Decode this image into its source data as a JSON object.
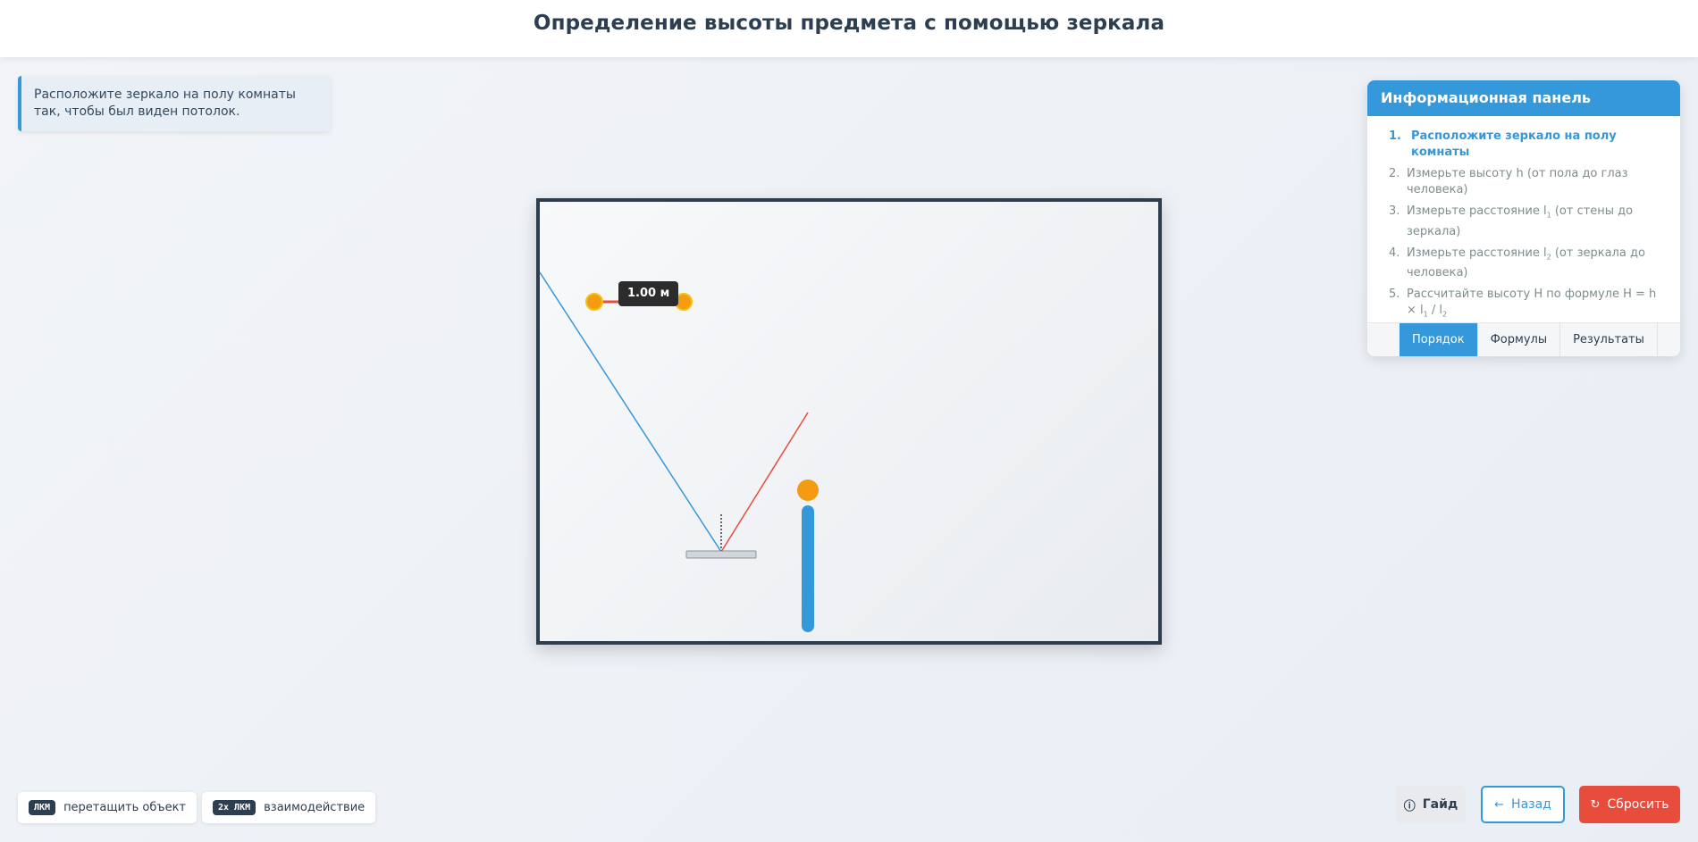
{
  "header": {
    "title": "Определение высоты предмета с помощью зеркала"
  },
  "hint": {
    "text": "Расположите зеркало на полу комнаты так, чтобы был виден потолок."
  },
  "scene": {
    "measure_label": "1.00 м",
    "colors": {
      "ray_incident": "#3498db",
      "ray_reflected": "#e74c3c",
      "person": "#3498db",
      "marker": "#f39c12"
    }
  },
  "info_panel": {
    "title": "Информационная панель",
    "steps": [
      {
        "num": "1.",
        "text": "Расположите зеркало на полу комнаты",
        "active": true
      },
      {
        "num": "2.",
        "text": "Измерьте высоту h (от пола до глаз человека)"
      },
      {
        "num": "3.",
        "text_pre": "Измерьте расстояние l",
        "sub": "1",
        "text_post": " (от стены до зеркала)"
      },
      {
        "num": "4.",
        "text_pre": "Измерьте расстояние l",
        "sub": "2",
        "text_post": " (от зеркала до человека)"
      },
      {
        "num": "5.",
        "text_pre": "Рассчитайте высоту H по формуле H = h × l",
        "sub": "1",
        "text_mid": " / l",
        "sub2": "2"
      }
    ],
    "tabs": [
      "Порядок",
      "Формулы",
      "Результаты"
    ],
    "active_tab": "Порядок"
  },
  "controls": [
    {
      "key": "ЛКМ",
      "label": "перетащить объект"
    },
    {
      "key": "2x ЛКМ",
      "label": "взаимодействие"
    }
  ],
  "buttons": {
    "guide": "Гайд",
    "back": "Назад",
    "reset": "Сбросить"
  }
}
